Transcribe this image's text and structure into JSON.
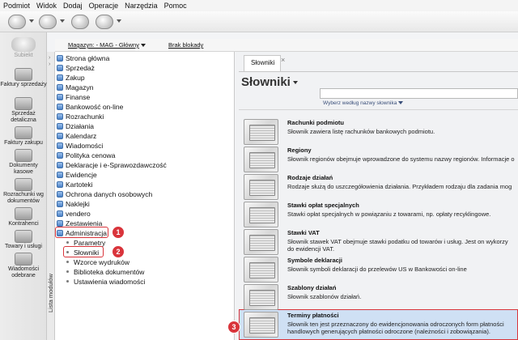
{
  "menu": [
    "Podmiot",
    "Widok",
    "Dodaj",
    "Operacje",
    "Narzędzia",
    "Pomoc"
  ],
  "brand": "Subiekt",
  "ribbon": [
    {
      "label": "Faktury sprzedaży",
      "icon": "invoice-icon"
    },
    {
      "label": "Sprzedaż detaliczna",
      "icon": "receipt-icon"
    },
    {
      "label": "Faktury zakupu",
      "icon": "purchase-invoice-icon"
    },
    {
      "label": "Dokumenty kasowe",
      "icon": "cash-documents-icon"
    },
    {
      "label": "Rozrachunki wg dokumentów",
      "icon": "settlements-icon"
    },
    {
      "label": "Kontrahenci",
      "icon": "contractors-icon"
    },
    {
      "label": "Towary i usługi",
      "icon": "goods-icon"
    },
    {
      "label": "Wiadomości odebrane",
      "icon": "messages-icon"
    }
  ],
  "magbar": {
    "magazyn": "Magazyn: - MAG - Główny",
    "brak": "Brak blokady"
  },
  "sidebar_label": "Lista modułów",
  "tree": [
    "Strona główna",
    "Sprzedaż",
    "Zakup",
    "Magazyn",
    "Finanse",
    "Bankowość on-line",
    "Rozrachunki",
    "Działania",
    "Kalendarz",
    "Wiadomości",
    "Polityka cenowa",
    "Deklaracje i e-Sprawozdawczość",
    "Ewidencje",
    "Kartoteki",
    "Ochrona danych osobowych",
    "Naklejki",
    "vendero",
    "Zestawienia",
    "Administracja"
  ],
  "tree_sub": [
    "Parametry",
    "Słowniki",
    "Wzorce wydruków",
    "Biblioteka dokumentów",
    "Ustawienia wiadomości"
  ],
  "badges": [
    "1",
    "2",
    "3"
  ],
  "tab": {
    "label": "Słowniki",
    "close": "×"
  },
  "heading": "Słowniki",
  "search": {
    "value": "",
    "sub_link": "Wyberz według nazwy słownika"
  },
  "dictionaries": [
    {
      "title": "Rachunki podmiotu",
      "desc": "Słownik zawiera listę rachunków bankowych podmiotu."
    },
    {
      "title": "Regiony",
      "desc": "Słownik regionów obejmuje wprowadzone do systemu nazwy regionów. Informacje o"
    },
    {
      "title": "Rodzaje działań",
      "desc": "Rodzaje służą do uszczegółowienia działania. Przykładem rodzaju dla zadania mog"
    },
    {
      "title": "Stawki opłat specjalnych",
      "desc": "Stawki opłat specjalnych w powiązaniu z towarami, np. opłaty recyklingowe."
    },
    {
      "title": "Stawki VAT",
      "desc": "Słownik stawek VAT obejmuje stawki podatku od towarów i usług. Jest on wykorzy",
      "desc2": "do ewidencji VAT."
    },
    {
      "title": "Symbole deklaracji",
      "desc": "Słownik symboli deklaracji do przelewów US w Bankowości on-line"
    },
    {
      "title": "Szablony działań",
      "desc": "Słownik szablonów działań."
    },
    {
      "title": "Terminy płatności",
      "desc": "Słownik ten jest przeznaczony do ewidencjonowania odroczonych form płatności",
      "desc2": "handlowych generujących płatności odroczone (należności i zobowiązania)."
    }
  ],
  "colors": {
    "highlight": "#d9343b",
    "selection": "#cfe0f4"
  }
}
